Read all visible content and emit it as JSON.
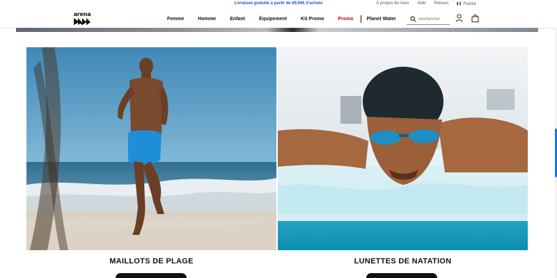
{
  "announcement": {
    "text": "Livraison gratuite à partir de 69,90€ d'achats"
  },
  "utility": {
    "about": "À propos de nous",
    "help": "Aide",
    "returns": "Retours",
    "country": "France"
  },
  "header": {
    "logo": "arena",
    "nav": [
      "Femme",
      "Homme",
      "Enfant",
      "Équipement",
      "Kit Promo",
      "Promo",
      "Planet Water"
    ],
    "search_placeholder": "Rechercher",
    "icons": [
      "search-icon",
      "account-icon",
      "bag-icon"
    ]
  },
  "cards": [
    {
      "title": "MAILLOTS DE PLAGE",
      "image": "running-man-on-beach"
    },
    {
      "title": "LUNETTES DE NATATION",
      "image": "swimmer-butterfly-stroke"
    }
  ],
  "colors": {
    "promo": "#d0021b",
    "announcement": "#1a56c8",
    "scrollbar": "#1a73e8"
  }
}
